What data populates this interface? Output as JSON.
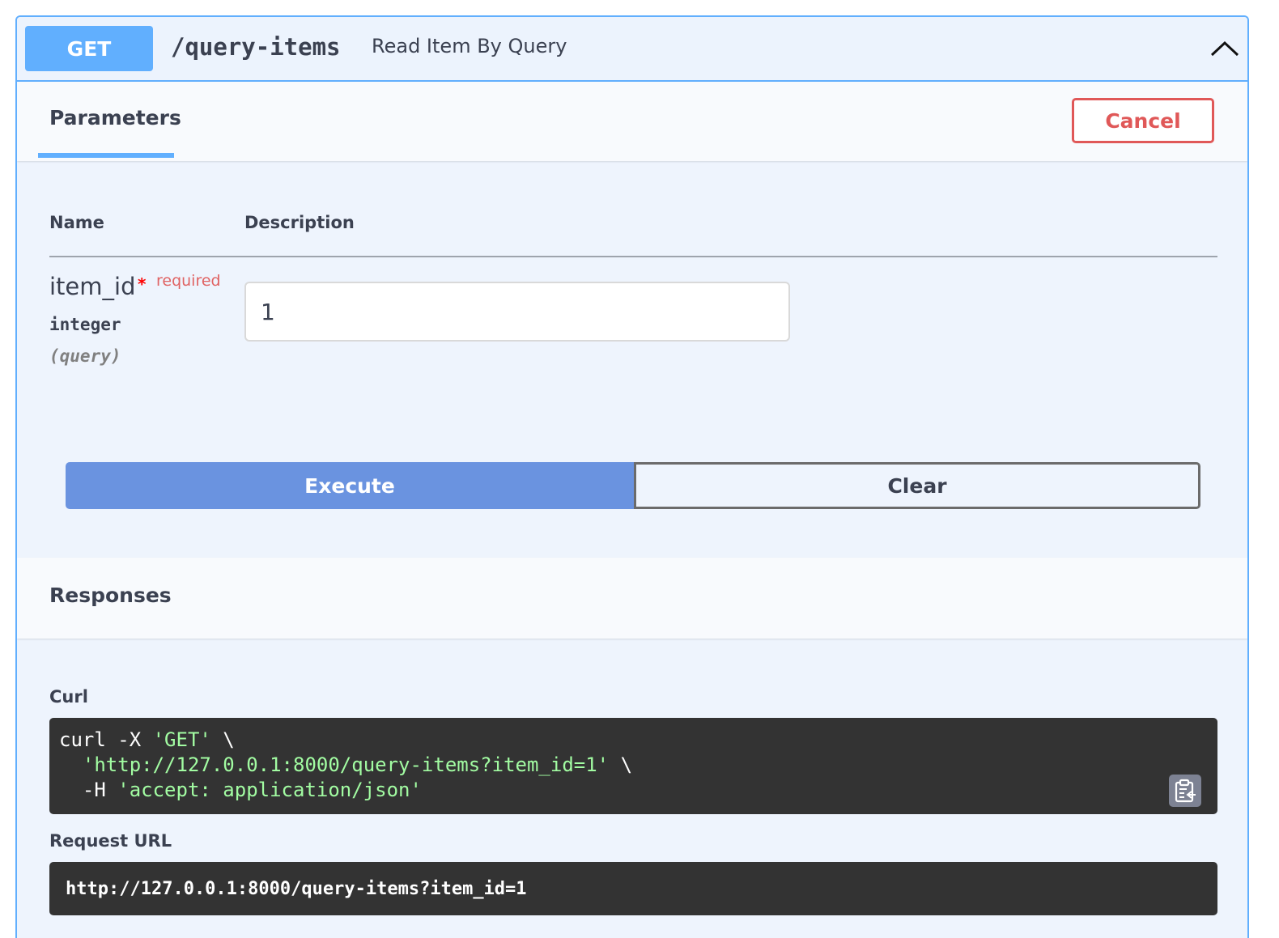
{
  "summary": {
    "method": "GET",
    "path": "/query-items",
    "description": "Read Item By Query",
    "collapse_icon": "chevron-up-icon"
  },
  "parameters": {
    "tab_label": "Parameters",
    "cancel_label": "Cancel",
    "col_name": "Name",
    "col_description": "Description",
    "items": [
      {
        "name": "item_id",
        "required_star": "*",
        "required_label": "required",
        "type": "integer",
        "in": "(query)",
        "value": "1"
      }
    ],
    "execute_label": "Execute",
    "clear_label": "Clear"
  },
  "responses": {
    "title": "Responses",
    "curl_label": "Curl",
    "curl": {
      "l1_cmd": "curl -X ",
      "l1_method": "'GET'",
      "l1_tail": " \\",
      "l2_indent": "  ",
      "l2_url": "'http://127.0.0.1:8000/query-items?item_id=1'",
      "l2_tail": " \\",
      "l3_cmd": "  -H ",
      "l3_header": "'accept: application/json'"
    },
    "copy_icon": "clipboard-copy-icon",
    "request_url_label": "Request URL",
    "request_url": "http://127.0.0.1:8000/query-items?item_id=1"
  },
  "colors": {
    "get_accent": "#61affe",
    "cancel_red": "#e05858",
    "execute_blue": "#6a93e0",
    "code_bg": "#333333",
    "code_string": "#a2fca2"
  }
}
